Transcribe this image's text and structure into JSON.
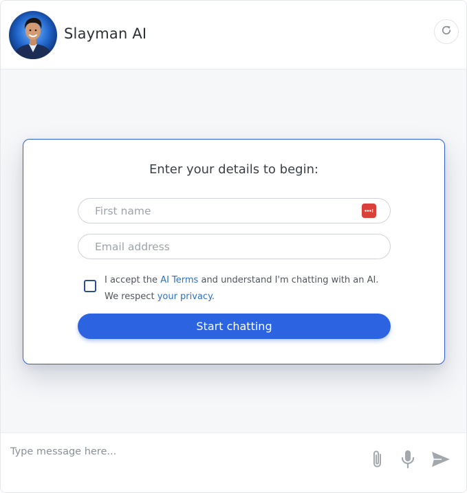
{
  "header": {
    "bot_name": "Slayman AI",
    "refresh_icon": "refresh-icon"
  },
  "form": {
    "title": "Enter your details to begin:",
    "first_name_placeholder": "First name",
    "first_name_value": "",
    "email_placeholder": "Email address",
    "email_value": "",
    "consent_checked": false,
    "terms_prefix": "I accept the ",
    "terms_link": "AI Terms",
    "terms_middle": " and understand I'm chatting with an AI.",
    "privacy_prefix": "We respect ",
    "privacy_link": "your privacy.",
    "start_label": "Start chatting"
  },
  "composer": {
    "placeholder": "Type message here...",
    "value": "",
    "icons": [
      "paperclip-icon",
      "microphone-icon",
      "send-icon"
    ]
  },
  "colors": {
    "accent": "#2c63e0",
    "card_border": "#2c5fd6",
    "link": "#2d6fc9",
    "password_badge": "#d9403a",
    "background": "#f6f7f9"
  }
}
